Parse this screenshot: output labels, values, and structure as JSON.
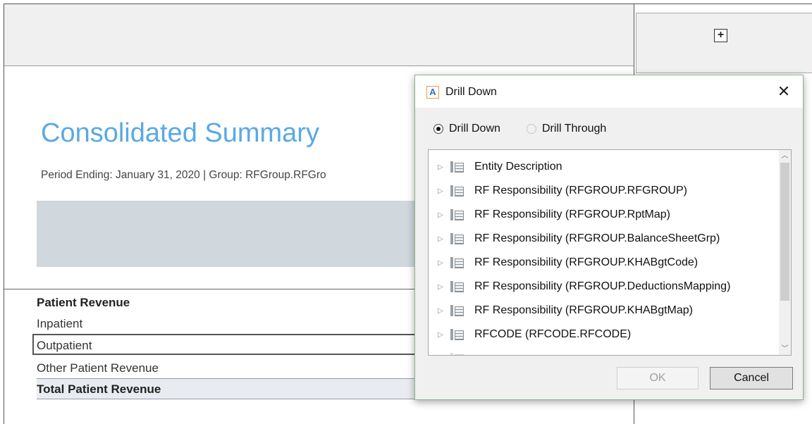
{
  "report": {
    "title": "Consolidated Summary",
    "subtitle": "Period Ending: January 31, 2020 | Group: RFGroup.RFGro",
    "add_button": "+",
    "rows": [
      {
        "label": "Patient Revenue"
      },
      {
        "label": "Inpatient"
      },
      {
        "label": "Outpatient"
      },
      {
        "label": "Other Patient Revenue"
      },
      {
        "label": "Total Patient Revenue"
      }
    ]
  },
  "dialog": {
    "app_icon_letter": "A",
    "title": "Drill Down",
    "close_glyph": "✕",
    "mode_options": [
      {
        "label": "Drill Down",
        "selected": true
      },
      {
        "label": "Drill Through",
        "selected": false
      }
    ],
    "tree_items": [
      {
        "label": "Entity Description"
      },
      {
        "label": "RF Responsibility (RFGROUP.RFGROUP)"
      },
      {
        "label": "RF Responsibility (RFGROUP.RptMap)"
      },
      {
        "label": "RF Responsibility (RFGROUP.BalanceSheetGrp)"
      },
      {
        "label": "RF Responsibility (RFGROUP.KHABgtCode)"
      },
      {
        "label": "RF Responsibility (RFGROUP.DeductionsMapping)"
      },
      {
        "label": "RF Responsibility (RFGROUP.KHABgtMap)"
      },
      {
        "label": "RFCODE (RFCODE.RFCODE)"
      }
    ],
    "ok_label": "OK",
    "ok_enabled": false,
    "cancel_label": "Cancel"
  },
  "icons": {
    "expander": "expand-triangle-icon",
    "table": "table-icon",
    "close": "close-icon"
  },
  "colors": {
    "title_blue": "#5aa9e6",
    "band_grey": "#d0d7dd",
    "dialog_bg": "#f0f0f0"
  }
}
